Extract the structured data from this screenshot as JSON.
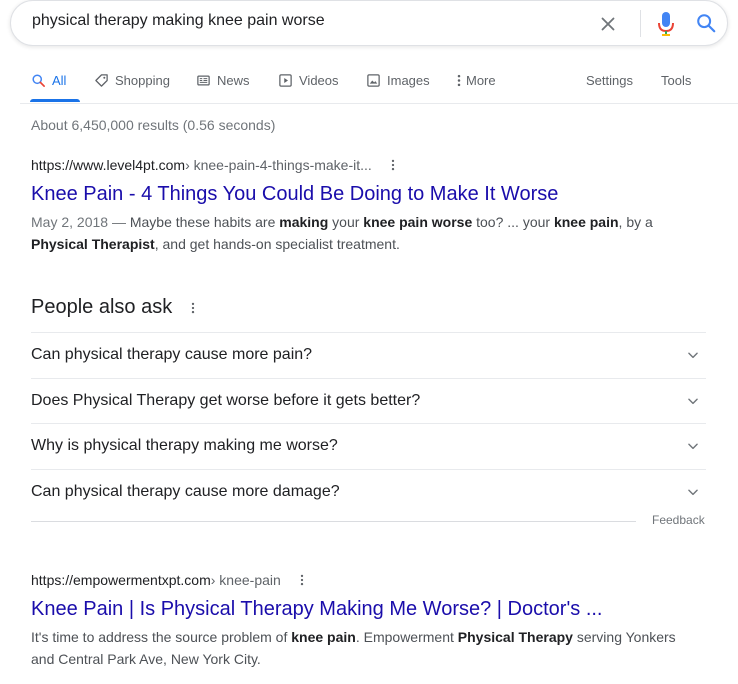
{
  "search": {
    "query": "physical therapy making knee pain worse"
  },
  "tabs": [
    {
      "label": "All",
      "icon": "search-icon"
    },
    {
      "label": "Shopping",
      "icon": "tag-icon"
    },
    {
      "label": "News",
      "icon": "newspaper-icon"
    },
    {
      "label": "Videos",
      "icon": "play-icon"
    },
    {
      "label": "Images",
      "icon": "image-icon"
    },
    {
      "label": "More",
      "icon": "more-vert-icon"
    },
    {
      "label": "Settings"
    },
    {
      "label": "Tools"
    }
  ],
  "stats": "About 6,450,000 results (0.56 seconds)",
  "results": [
    {
      "site": "https://www.level4pt.com",
      "path": " › knee-pain-4-things-make-it...",
      "title": "Knee Pain - 4 Things You Could Be Doing to Make It Worse",
      "snippet": {
        "date": "May 2, 2018",
        "dash": " — ",
        "p1": "Maybe these habits are ",
        "b1": "making",
        "p2": " your ",
        "b2": "knee pain worse",
        "p3": " too? ... your ",
        "b3": "knee pain",
        "p4": ", by a ",
        "b4": "Physical Therapist",
        "p5": ", and get hands-on specialist treatment."
      }
    },
    {
      "site": "https://empowermentxpt.com",
      "path": " › knee-pain",
      "title": "Knee Pain | Is Physical Therapy Making Me Worse? | Doctor's ...",
      "snippet": {
        "p1": "It's time to address the source problem of ",
        "b1": "knee pain",
        "p2": ". Empowerment ",
        "b2": "Physical Therapy",
        "p3": " serving Yonkers and Central Park Ave, New York City."
      }
    }
  ],
  "paa": {
    "title": "People also ask",
    "questions": [
      "Can physical therapy cause more pain?",
      "Does Physical Therapy get worse before it gets better?",
      "Why is physical therapy making me worse?",
      "Can physical therapy cause more damage?"
    ],
    "feedback": "Feedback"
  },
  "colors": {
    "link": "#1a0dab",
    "accent": "#1a73e8",
    "muted": "#70757a"
  }
}
